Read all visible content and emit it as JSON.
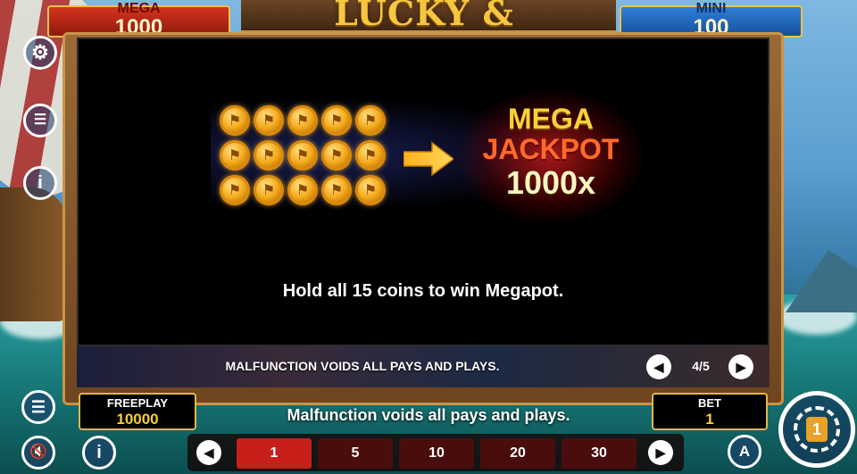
{
  "jackpots": {
    "mega": {
      "label": "MEGA",
      "value": "1000"
    },
    "mini": {
      "label": "MINI",
      "value": "100"
    }
  },
  "logo": {
    "text": "LUCKY & BRAVE"
  },
  "paytable": {
    "coins_count": 15,
    "prize_line1": "MEGA",
    "prize_line2": "JACKPOT",
    "prize_line3": "1000x",
    "rule_text": "Hold all 15 coins to win Megapot.",
    "malfunction_text": "MALFUNCTION VOIDS ALL PAYS AND PLAYS.",
    "page_indicator": "4/5",
    "prev_icon": "chevron-left-icon",
    "next_icon": "chevron-right-icon"
  },
  "freeplay": {
    "label": "FREEPLAY",
    "value": "10000"
  },
  "bet": {
    "label": "BET",
    "value": "1"
  },
  "footer_notice": "Malfunction voids all pays and plays.",
  "bet_options": [
    "1",
    "5",
    "10",
    "20",
    "30"
  ],
  "selected_bet": "1",
  "side_icons": {
    "settings": "gear-icon",
    "stack": "coin-stack-icon",
    "info": "info-icon",
    "menu": "menu-icon",
    "sound": "sound-muted-icon",
    "info_bottom": "info-icon",
    "autoplay": "autoplay-icon",
    "spin": "spin-icon"
  },
  "spin_badge": "1",
  "colors": {
    "accent_gold": "#f6cf3a",
    "selected_bet": "#c7201a",
    "mega_red": "#d4341e",
    "mini_blue": "#2e7fd8"
  }
}
